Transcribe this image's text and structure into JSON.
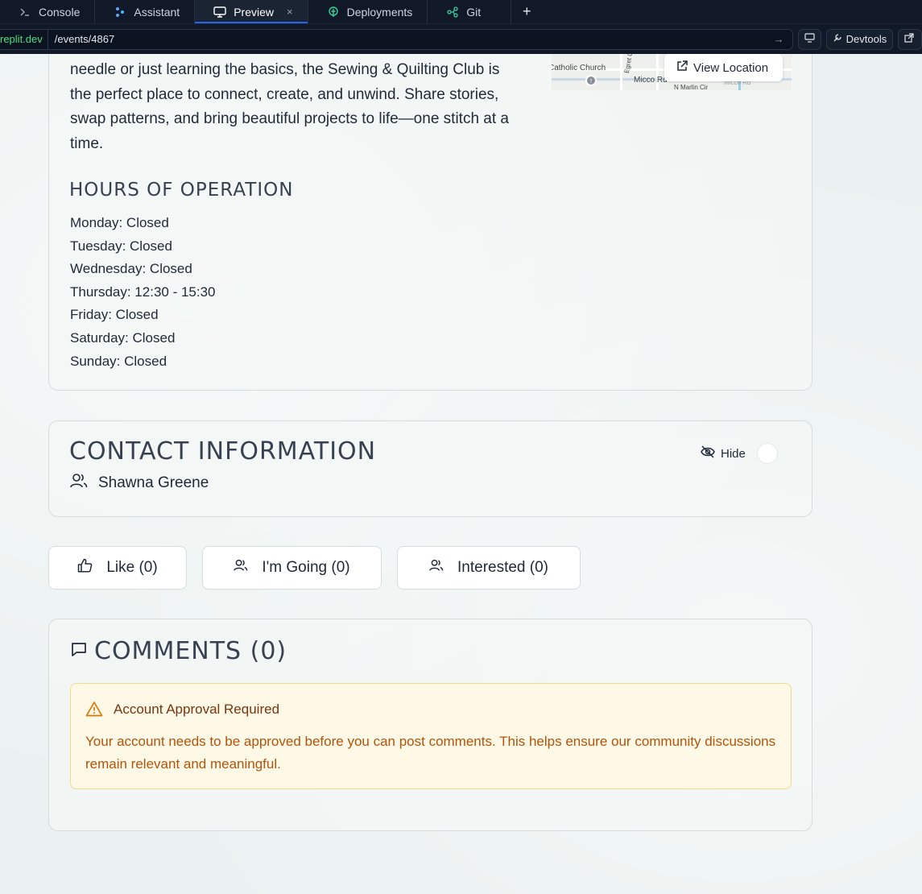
{
  "browser": {
    "tabs": [
      {
        "label": "Console",
        "icon": "terminal-icon"
      },
      {
        "label": "Assistant",
        "icon": "assistant-icon"
      },
      {
        "label": "Preview",
        "icon": "monitor-icon",
        "active": true,
        "close": "×"
      },
      {
        "label": "Deployments",
        "icon": "deploy-icon"
      },
      {
        "label": "Git",
        "icon": "git-icon"
      }
    ],
    "add_tab": "+",
    "url_domain": "replit.dev",
    "url_path": "/events/4867",
    "go": "→",
    "devtools_label": "Devtools"
  },
  "about": {
    "text": "needle or just learning the basics, the Sewing & Quilting Club is the perfect place to connect, create, and unwind. Share stories, swap patterns, and bring beautiful projects to life—one stitch at a time.",
    "map_labels": {
      "church": "Catholic Church",
      "road1": "Micco Rd",
      "road2": "N Marlin Cir",
      "road3": "Egret C",
      "road4": "Micco Rd"
    },
    "view_location": "View Location"
  },
  "hours": {
    "title": "HOURS OF OPERATION",
    "days": [
      "Monday: Closed",
      "Tuesday: Closed",
      "Wednesday: Closed",
      "Thursday: 12:30 - 15:30",
      "Friday: Closed",
      "Saturday: Closed",
      "Sunday: Closed"
    ]
  },
  "contact": {
    "title": "CONTACT INFORMATION",
    "name": "Shawna Greene",
    "hide_label": "Hide"
  },
  "actions": {
    "like": "Like (0)",
    "going": "I'm Going (0)",
    "interested": "Interested (0)"
  },
  "comments": {
    "title": "COMMENTS (0)",
    "alert_title": "Account Approval Required",
    "alert_body": "Your account needs to be approved before you can post comments. This helps ensure our community discussions remain relevant and meaningful."
  },
  "colors": {
    "accent_tab": "#2563eb",
    "url_domain": "#4ade80",
    "alert_bg": "#fef9e6",
    "alert_text": "#b45309"
  }
}
